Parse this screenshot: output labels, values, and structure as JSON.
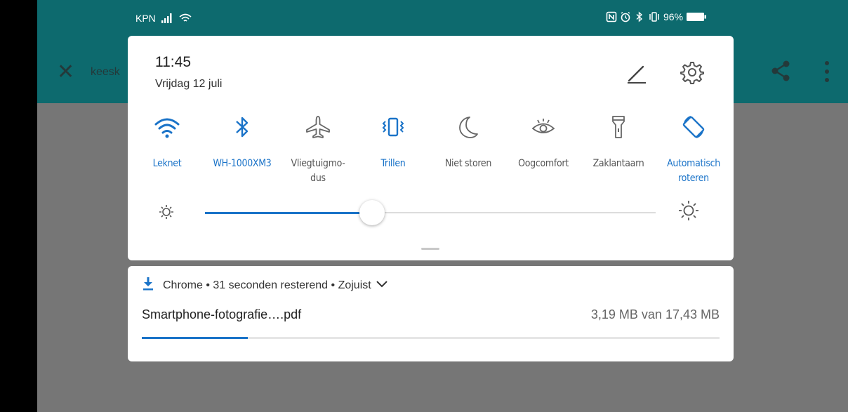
{
  "status_bar": {
    "carrier": "KPN",
    "battery": "96%"
  },
  "background_app": {
    "title": "keesk"
  },
  "quick_settings": {
    "time": "11:45",
    "date": "Vrijdag 12 juli",
    "tiles": [
      {
        "label": "Leknet",
        "icon": "wifi-icon",
        "active": true
      },
      {
        "label": "WH-1000XM3",
        "icon": "bluetooth-icon",
        "active": true
      },
      {
        "label": "Vliegtuigmo-\ndus",
        "icon": "airplane-icon",
        "active": false
      },
      {
        "label": "Trillen",
        "icon": "vibrate-icon",
        "active": true
      },
      {
        "label": "Niet storen",
        "icon": "moon-icon",
        "active": false
      },
      {
        "label": "Oogcomfort",
        "icon": "eye-icon",
        "active": false
      },
      {
        "label": "Zaklantaarn",
        "icon": "flashlight-icon",
        "active": false
      },
      {
        "label": "Automatisch\nroteren",
        "icon": "auto-rotate-icon",
        "active": true
      }
    ],
    "brightness": 0.37,
    "colors": {
      "accent": "#1a73c8",
      "inactive": "#555555"
    }
  },
  "notification": {
    "app": "Chrome",
    "remaining": "31 seconden resterend",
    "time": "Zojuist",
    "file_name": "Smartphone-fotografie….pdf",
    "size_text": "3,19 MB van 17,43 MB",
    "progress": 0.183
  }
}
